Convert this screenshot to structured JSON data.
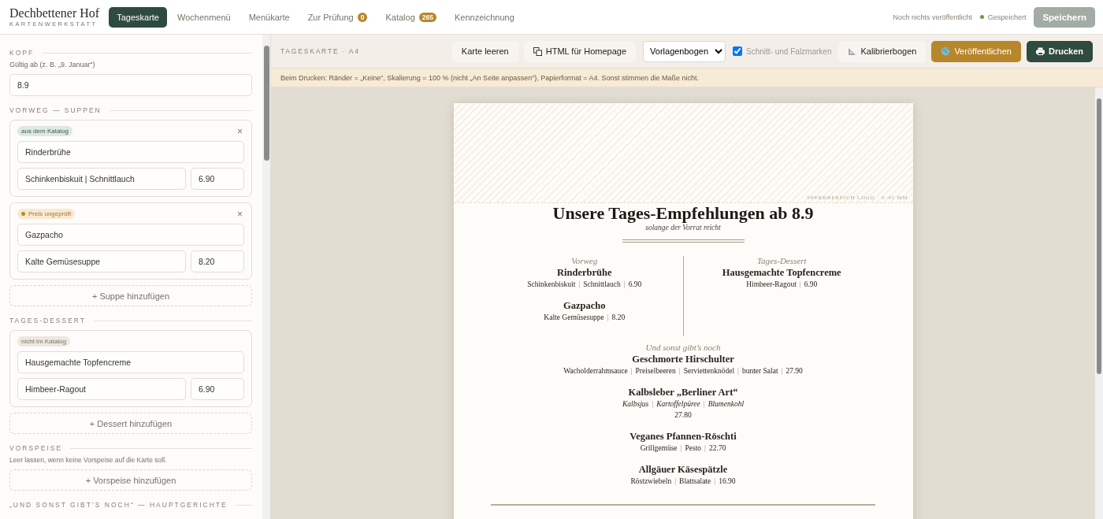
{
  "header": {
    "brand": "Dechbettener Hof",
    "brand_sub": "KARTENWERKSTATT",
    "tabs": [
      {
        "label": "Tageskarte",
        "selected": true
      },
      {
        "label": "Wochenmenü",
        "selected": false
      },
      {
        "label": "Menükarte",
        "selected": false
      },
      {
        "label": "Zur Prüfung",
        "selected": false,
        "badge": "0"
      },
      {
        "label": "Katalog",
        "selected": false,
        "badge": "265"
      },
      {
        "label": "Kennzeichnung",
        "selected": false
      }
    ],
    "publish_status": "Noch nichts veröffentlicht",
    "save_status": "Gespeichert",
    "save_button": {
      "label": "Speichern",
      "disabled": true
    }
  },
  "sidebar": {
    "sections": [
      {
        "kind": "field",
        "heading": "KOPF",
        "label": "Gültig ab (z. B. „9. Januar“)",
        "value": "8.9"
      },
      {
        "kind": "cards",
        "heading": "VORWEG — SUPPEN",
        "cards": [
          {
            "tag": {
              "label": "aus dem Katalog",
              "kind": "catalog"
            },
            "remove": "×",
            "name": "Rinderbrühe",
            "description": "Schinkenbiskuit | Schnittlauch",
            "price": "6.90"
          },
          {
            "tag": {
              "label": "Preis ungeprüft",
              "kind": "unchecked"
            },
            "remove": "×",
            "name": "Gazpacho",
            "description": "Kalte Gemüsesuppe",
            "price": "8.20"
          }
        ],
        "add_button": "+ Suppe hinzufügen"
      },
      {
        "kind": "cards",
        "heading": "TAGES-DESSERT",
        "cards": [
          {
            "tag": {
              "label": "nicht im Katalog",
              "kind": "other"
            },
            "name": "Hausgemachte Topfencreme",
            "description": "Himbeer-Ragout",
            "price": "6.90"
          }
        ],
        "add_button": "+ Dessert hinzufügen"
      },
      {
        "kind": "empty",
        "heading": "VORSPEISE",
        "hint": "Leer lassen, wenn keine Vorspeise auf die Karte soll.",
        "add_button": "+ Vorspeise hinzufügen"
      },
      {
        "kind": "heading",
        "heading": "„UND SONST GIBT’S NOCH“ — HAUPTGERICHTE"
      }
    ]
  },
  "toolbar": {
    "label": "TAGESKARTE · A4",
    "clear_button": "Karte leeren",
    "html_button": "HTML für Homepage",
    "template_select": "Vorlagenbogen",
    "marks_checkbox": {
      "label": "Schnitt- und Falzmarken",
      "checked": true
    },
    "calibrate_button": "Kalibrierbogen",
    "publish_button": "Veröffentlichen",
    "print_button": "Drucken"
  },
  "notice": "Beim Drucken: Ränder = „Keine“, Skalierung = 100 % (nicht „An Seite anpassen“), Papierformat = A4. Sonst stimmen die Maße nicht.",
  "paper": {
    "logo_zone_label": "SPERRBEREICH LOGO · 0–45 MM",
    "title": "Unsere Tages-Empfehlungen ab 8.9",
    "subtitle": "solange der Vorrat reicht",
    "separator": "|",
    "columns": [
      {
        "heading": "Vorweg",
        "items": [
          {
            "kind": "inline",
            "name": "Rinderbrühe",
            "details": [
              "Schinkenbiskuit",
              "Schnittlauch"
            ],
            "price": "6.90"
          },
          {
            "kind": "inline",
            "name": "Gazpacho",
            "details": [
              "Kalte Gemüsesuppe"
            ],
            "price": "8.20"
          }
        ]
      },
      {
        "heading": "Tages-Dessert",
        "items": [
          {
            "kind": "inline",
            "name": "Hausgemachte Topfencreme",
            "details": [
              "Himbeer-Ragout"
            ],
            "price": "6.90"
          }
        ]
      }
    ],
    "mains": {
      "heading": "Und sonst gibt’s noch",
      "items": [
        {
          "kind": "inline",
          "name": "Geschmorte Hirschulter",
          "details": [
            "Wacholderrahmsauce",
            "Preiselbeeren",
            "Serviettenknödel",
            "bunter Salat"
          ],
          "price": "27.90"
        },
        {
          "kind": "stacked",
          "name": "Kalbsleber „Berliner Art“",
          "details": [
            "Kalbsjus",
            "Kartoffelpüree",
            "Blumenkohl"
          ],
          "price": "27.80"
        },
        {
          "kind": "inline",
          "name": "Veganes Pfannen-Röschti",
          "details": [
            "Grillgemüse",
            "Pesto"
          ],
          "price": "22.70"
        },
        {
          "kind": "inline",
          "name": "Allgäuer Käsespätzle",
          "details": [
            "Röstzwiebeln",
            "Blattsalate"
          ],
          "price": "16.90"
        }
      ]
    }
  }
}
